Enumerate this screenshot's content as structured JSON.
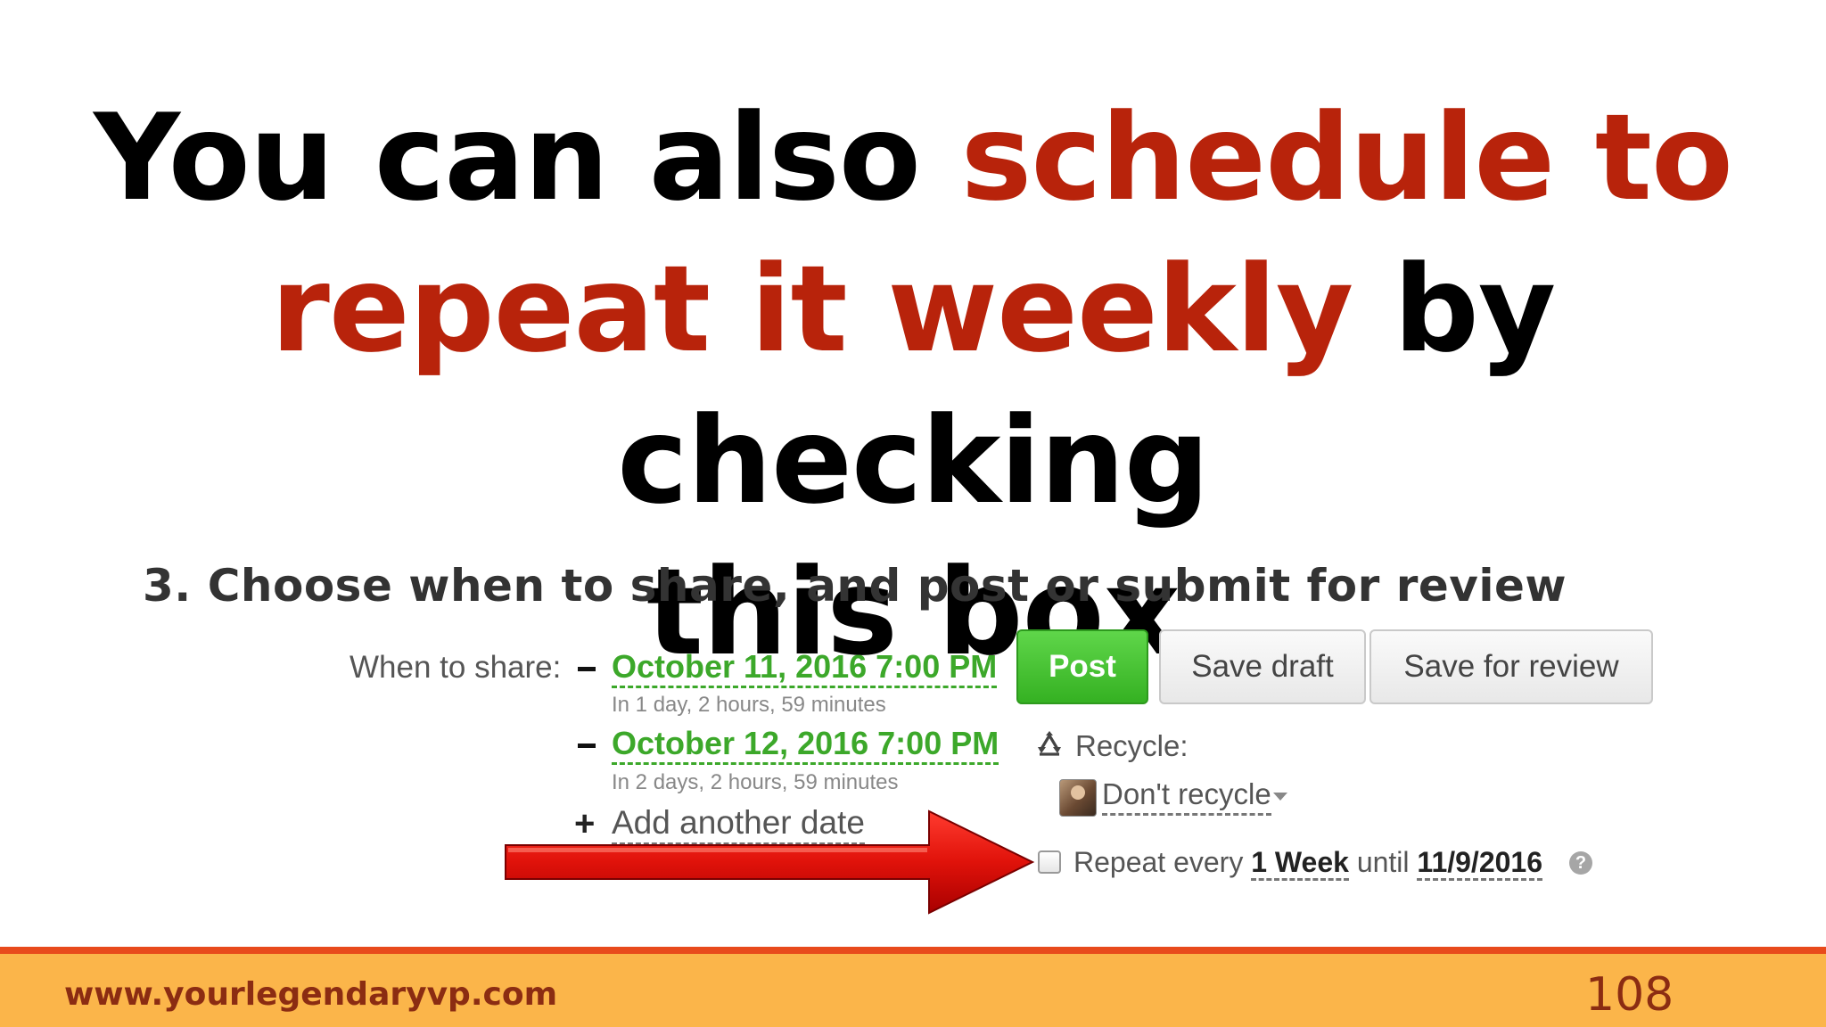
{
  "slide": {
    "headline": {
      "line1_a": "You can also ",
      "line1_b": "schedule to",
      "line2_a": "repeat it weekly",
      "line2_b": " by checking",
      "line3": "this box"
    },
    "highlight_color": "#b8230b"
  },
  "scheduler": {
    "section_title": "3. Choose when to share, and post or submit for review",
    "when_label": "When to share:",
    "dates": [
      {
        "date": "October 11, 2016 7:00 PM",
        "relative": "In 1 day, 2 hours, 59 minutes"
      },
      {
        "date": "October 12, 2016 7:00 PM",
        "relative": "In 2 days, 2 hours, 59 minutes"
      }
    ],
    "add_date": "Add another date",
    "buttons": {
      "post": "Post",
      "save_draft": "Save draft",
      "save_review": "Save for review"
    },
    "recycle": {
      "label": "Recycle:",
      "selected": "Don't recycle"
    },
    "repeat": {
      "checked": false,
      "prefix": "Repeat every",
      "interval": "1 Week",
      "until_label": "until",
      "until_date": "11/9/2016",
      "help": "?"
    },
    "accent_green": "#3ca82a"
  },
  "footer": {
    "url": "www.yourlegendaryvp.com",
    "page_number": "108"
  },
  "icons": [
    "minus-icon",
    "plus-icon",
    "recycle-icon",
    "chevron-down-icon",
    "help-icon",
    "red-arrow-icon"
  ]
}
